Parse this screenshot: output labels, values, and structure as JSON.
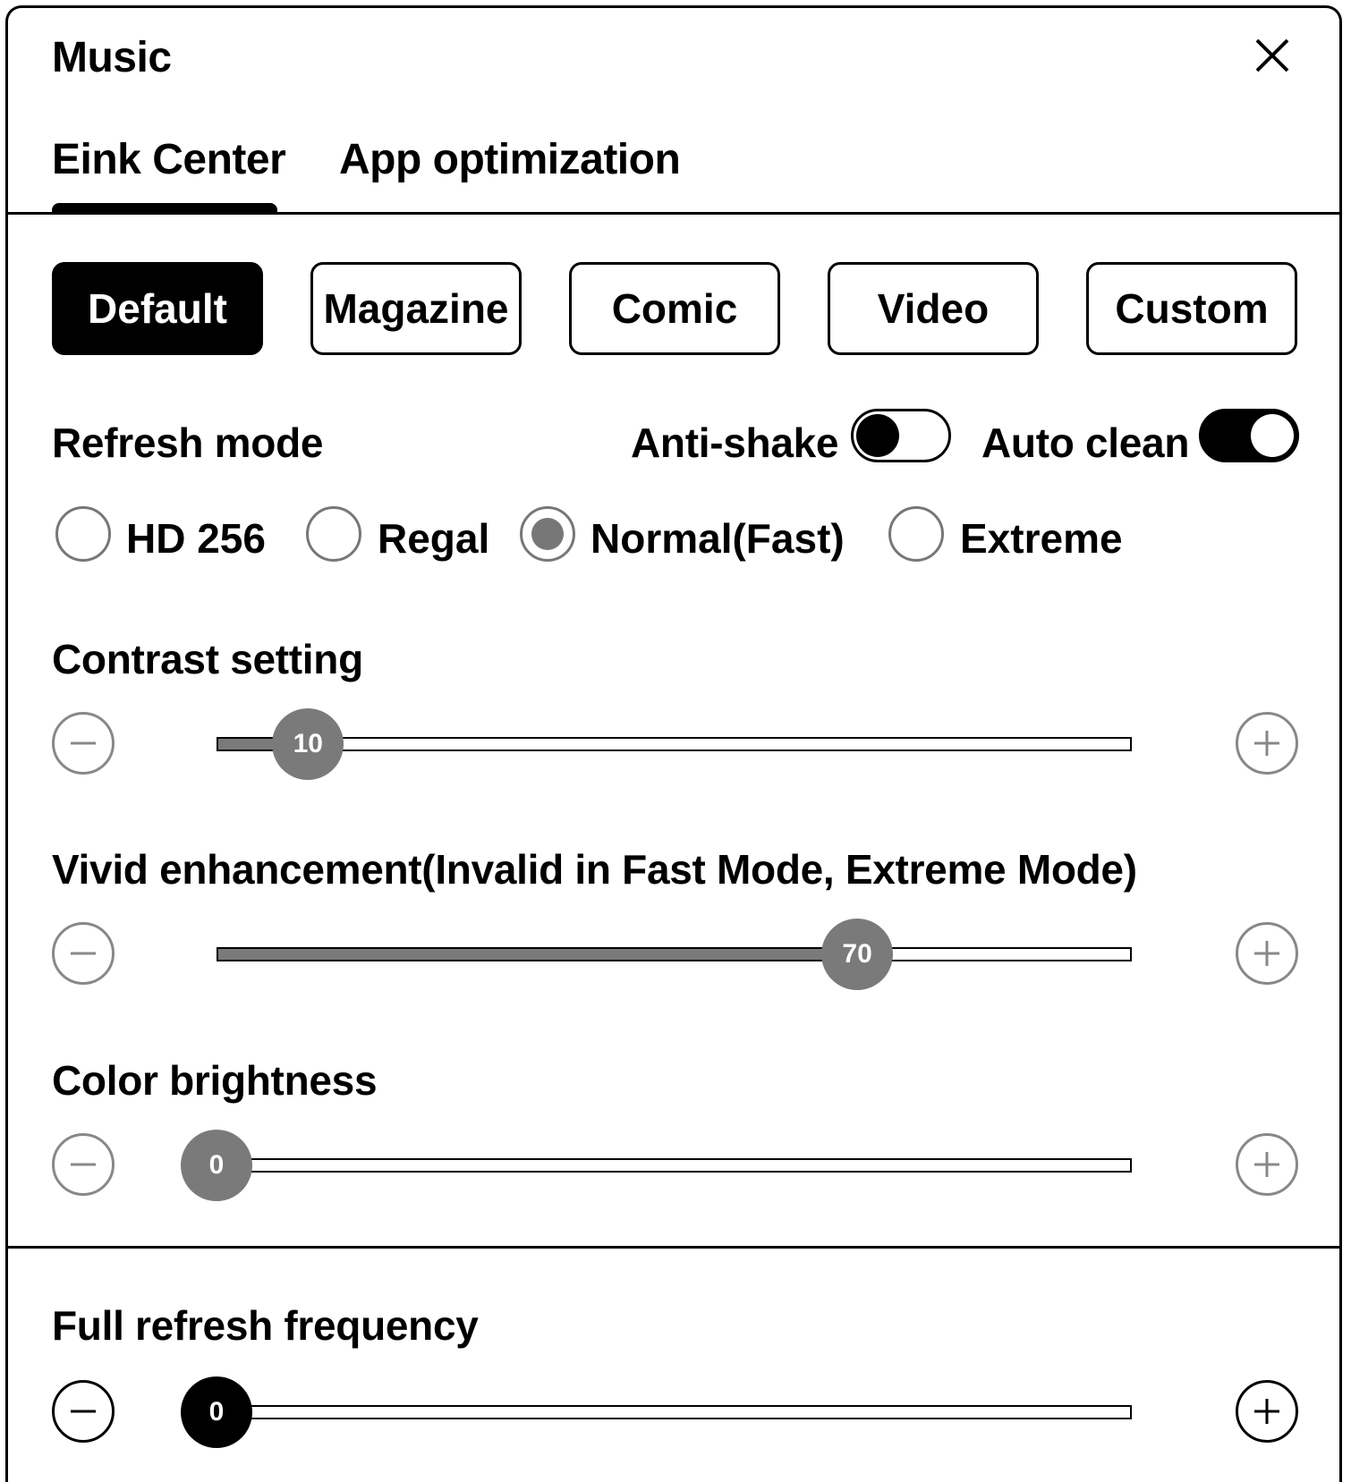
{
  "dialog": {
    "title": "Music"
  },
  "tabs": [
    {
      "label": "Eink Center",
      "active": true
    },
    {
      "label": "App optimization",
      "active": false
    }
  ],
  "presets": [
    {
      "label": "Default",
      "active": true
    },
    {
      "label": "Magazine",
      "active": false
    },
    {
      "label": "Comic",
      "active": false
    },
    {
      "label": "Video",
      "active": false
    },
    {
      "label": "Custom",
      "active": false
    }
  ],
  "refresh": {
    "label": "Refresh mode",
    "anti_shake": {
      "label": "Anti-shake",
      "on": false
    },
    "auto_clean": {
      "label": "Auto clean",
      "on": true
    },
    "modes": [
      {
        "label": "HD 256",
        "selected": false
      },
      {
        "label": "Regal",
        "selected": false
      },
      {
        "label": "Normal(Fast)",
        "selected": true
      },
      {
        "label": "Extreme",
        "selected": false
      }
    ]
  },
  "sliders": {
    "contrast": {
      "label": "Contrast setting",
      "value": "10",
      "fraction": 0.1
    },
    "vivid": {
      "label": "Vivid enhancement(Invalid in Fast Mode, Extreme Mode)",
      "value": "70",
      "fraction": 0.7
    },
    "brightness": {
      "label": "Color brightness",
      "value": "0",
      "fraction": 0.0
    },
    "full_refresh": {
      "label": "Full refresh frequency",
      "value": "0",
      "fraction": 0.0
    }
  },
  "icons": {
    "close": "close-icon",
    "minus": "minus-icon",
    "plus": "plus-icon"
  },
  "colors": {
    "primary": "#000000",
    "muted": "#7a7a7a",
    "background": "#ffffff"
  }
}
